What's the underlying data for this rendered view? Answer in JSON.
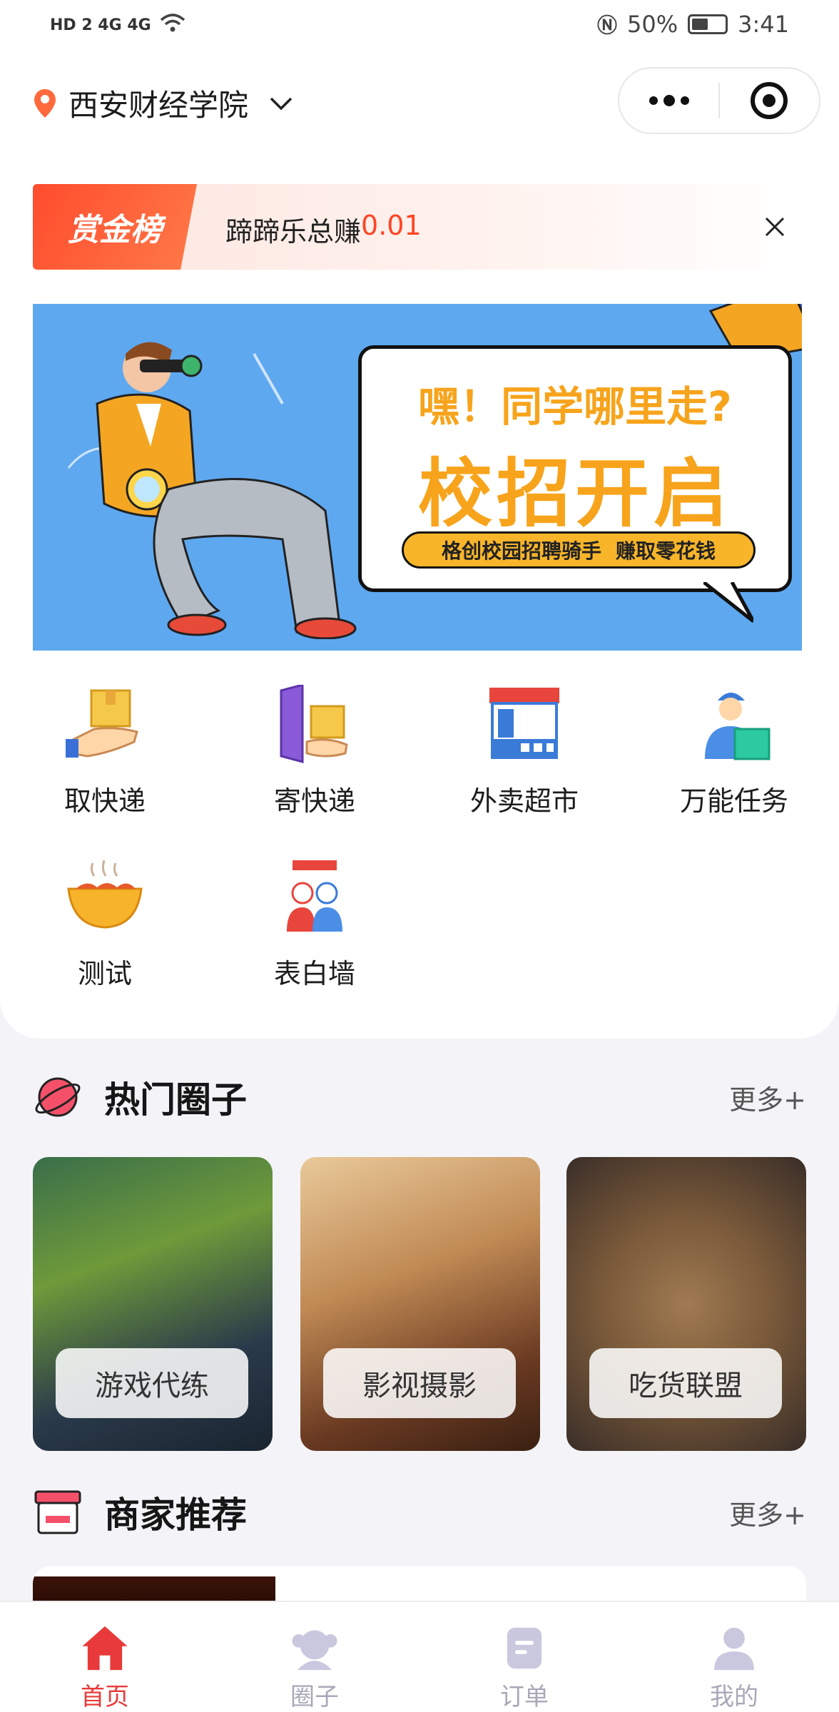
{
  "status_bar": {
    "left": "HD 2  4G  4G",
    "battery": "50%",
    "battery_level": 0.5,
    "time": "3:41"
  },
  "header": {
    "location": "西安财经学院"
  },
  "bounty": {
    "tag": "赏金榜",
    "text": "蹄蹄乐总赚",
    "amount": "0.01"
  },
  "banner": {
    "line1": "嘿！同学哪里走?",
    "line2": "校招开启",
    "pill_left": "格创校园招聘骑手",
    "pill_right": "赚取零花钱"
  },
  "services": [
    {
      "label": "取快递",
      "icon": "parcel-pickup-icon"
    },
    {
      "label": "寄快递",
      "icon": "parcel-send-icon"
    },
    {
      "label": "外卖超市",
      "icon": "store-icon"
    },
    {
      "label": "万能任务",
      "icon": "courier-icon"
    },
    {
      "label": "测试",
      "icon": "hot-pot-icon"
    },
    {
      "label": "表白墙",
      "icon": "couple-icon"
    }
  ],
  "hot_circles": {
    "title": "热门圈子",
    "more": "更多+",
    "items": [
      {
        "label": "游戏代练"
      },
      {
        "label": "影视摄影"
      },
      {
        "label": "吃货联盟"
      }
    ]
  },
  "merchants": {
    "title": "商家推荐",
    "more": "更多+"
  },
  "tabbar": [
    {
      "label": "首页",
      "active": true
    },
    {
      "label": "圈子",
      "active": false
    },
    {
      "label": "订单",
      "active": false
    },
    {
      "label": "我的",
      "active": false
    }
  ],
  "colors": {
    "accent": "#e83a3a",
    "bounty": "#ff4c2e",
    "banner_bg": "#5ea8f0",
    "banner_text": "#f7a41c"
  }
}
